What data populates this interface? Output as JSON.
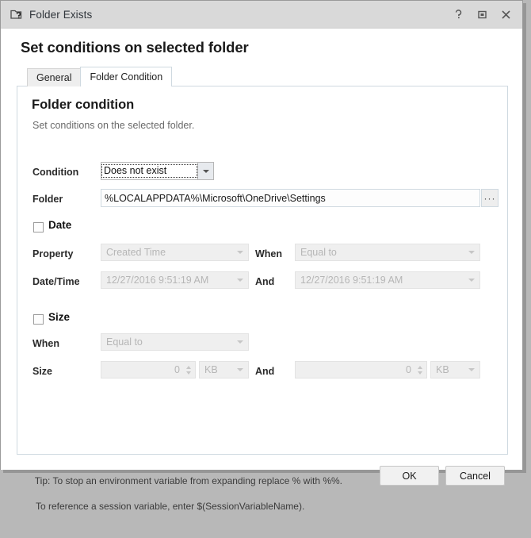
{
  "window": {
    "title": "Folder Exists",
    "icon": "folder-question-icon",
    "buttons": [
      {
        "name": "help-button",
        "icon": "help-icon",
        "label": "?"
      },
      {
        "name": "restore-button",
        "icon": "restore-icon",
        "label": "□"
      },
      {
        "name": "close-button",
        "icon": "close-icon",
        "label": "✕"
      }
    ]
  },
  "header": {
    "title": "Set conditions on selected folder"
  },
  "tabs": [
    {
      "label": "General",
      "active": false
    },
    {
      "label": "Folder Condition",
      "active": true
    }
  ],
  "panel": {
    "title": "Folder condition",
    "subtitle": "Set conditions on the selected folder.",
    "condition": {
      "label": "Condition",
      "value": "Does not exist",
      "focused": true
    },
    "folder": {
      "label": "Folder",
      "value": "%LOCALAPPDATA%\\Microsoft\\OneDrive\\Settings",
      "browse_label": "···"
    },
    "date_group": {
      "label": "Date",
      "checked": false,
      "enabled": false,
      "property_label": "Property",
      "property_value": "Created Time",
      "when_label": "When",
      "when_value": "Equal to",
      "datetime_label": "Date/Time",
      "datetime_value": "12/27/2016 9:51:19 AM",
      "and_label": "And",
      "and_value": "12/27/2016 9:51:19 AM"
    },
    "size_group": {
      "label": "Size",
      "checked": false,
      "enabled": false,
      "when_label": "When",
      "when_value": "Equal to",
      "size_label": "Size",
      "size_value": "0",
      "size_unit": "KB",
      "and_label": "And",
      "and_value": "0",
      "and_unit": "KB"
    }
  },
  "footer": {
    "tip_line1": "Tip: To stop an environment variable from expanding replace % with %%.",
    "tip_line2": "To reference a session variable, enter $(SessionVariableName).",
    "ok_label": "OK",
    "cancel_label": "Cancel"
  },
  "colors": {
    "titlebar": "#d9d9d9",
    "panel_border": "#cfd9e0",
    "disabled_text": "#b6b6b6",
    "window_bg": "#ffffff",
    "desktop": "#b8b8b8"
  }
}
